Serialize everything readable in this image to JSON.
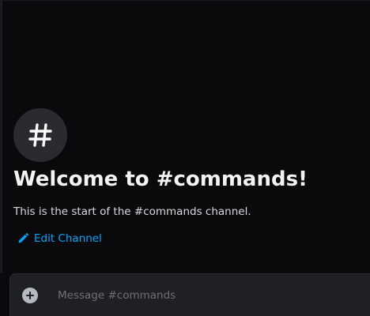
{
  "welcome": {
    "title": "Welcome to #commands!",
    "subtitle": "This is the start of the #commands channel."
  },
  "edit_channel": {
    "label": "Edit Channel",
    "icon": "pencil-icon"
  },
  "channel_icon": {
    "icon": "hashtag-icon"
  },
  "composer": {
    "placeholder": "Message #commands",
    "value": "",
    "add_icon": "plus-circle-icon"
  },
  "colors": {
    "background": "#0a0a0c",
    "icon_circle": "#2a2b31",
    "title": "#f2f3f5",
    "text": "#d7d9dc",
    "link": "#00a8fc",
    "composer_bg": "#1f2024",
    "placeholder": "#6d6f78"
  }
}
